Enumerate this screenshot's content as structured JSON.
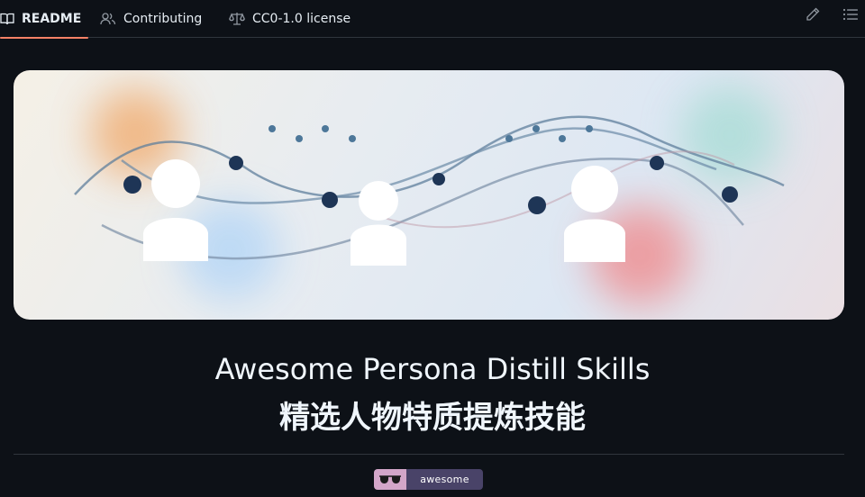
{
  "tabs": [
    {
      "label": "README",
      "icon": "book-icon",
      "active": true
    },
    {
      "label": "Contributing",
      "icon": "people-icon",
      "active": false
    },
    {
      "label": "CC0-1.0 license",
      "icon": "law-scale-icon",
      "active": false
    }
  ],
  "toolbar": {
    "edit_icon": "pencil-icon",
    "outline_icon": "list-unordered-icon"
  },
  "readme": {
    "title_en": "Awesome Persona Distill Skills",
    "title_zh": "精选人物特质提炼技能",
    "badge_label": "awesome",
    "badge_icon": "sunglasses-icon"
  },
  "colors": {
    "accent_underline": "#f78166",
    "page_background": "#0d1117",
    "badge_left": "#d3a6c9",
    "badge_right": "#494368"
  }
}
